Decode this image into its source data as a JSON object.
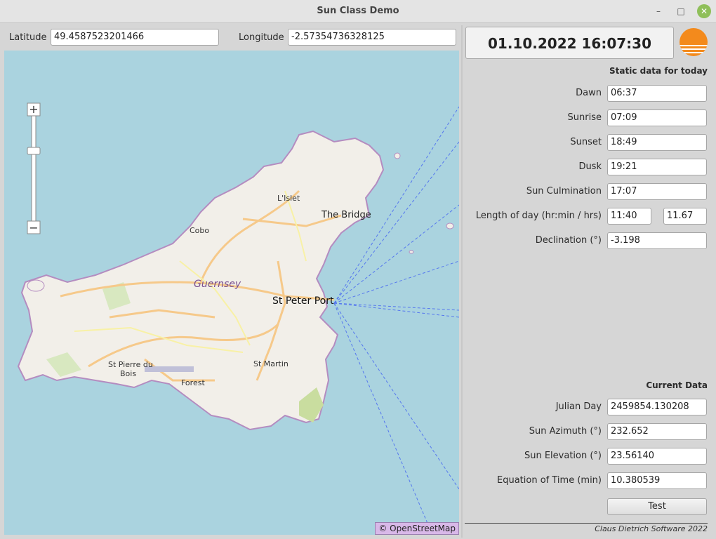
{
  "window": {
    "title": "Sun Class Demo"
  },
  "controls": {
    "minimize": "–",
    "maximize": "□",
    "close": "✕"
  },
  "coordinates": {
    "latitude_label": "Latitude",
    "latitude_value": "49.4587523201466",
    "longitude_label": "Longitude",
    "longitude_value": "-2.57354736328125"
  },
  "map": {
    "attribution": "© OpenStreetMap",
    "zoom_in": "+",
    "zoom_out": "−",
    "places": {
      "lislet": "L'Islet",
      "the_bridge": "The Bridge",
      "cobo": "Cobo",
      "guernsey": "Guernsey",
      "st_peter_port": "St Peter Port",
      "st_pierre_du": "St Pierre du",
      "bois": "Bois",
      "forest": "Forest",
      "st_martin": "St Martin"
    },
    "colors": {
      "sea": "#aad3df",
      "land": "#f2efe9",
      "road": "#f6c98a",
      "rays": "#5577ee"
    }
  },
  "datetime": "01.10.2022 16:07:30",
  "sun_icon_color": "#f38a1c",
  "static": {
    "title": "Static data for today",
    "dawn_label": "Dawn",
    "dawn": "06:37",
    "sunrise_label": "Sunrise",
    "sunrise": "07:09",
    "sunset_label": "Sunset",
    "sunset": "18:49",
    "dusk_label": "Dusk",
    "dusk": "19:21",
    "culmination_label": "Sun Culmination",
    "culmination": "17:07",
    "length_label": "Length of day (hr:min / hrs)",
    "length_hm": "11:40",
    "length_hrs": "11.67",
    "declination_label": "Declination (°)",
    "declination": "-3.198"
  },
  "current": {
    "title": "Current Data",
    "julian_label": "Julian Day",
    "julian": "2459854.130208",
    "azimuth_label": "Sun Azimuth (°)",
    "azimuth": "232.652",
    "elevation_label": "Sun Elevation (°)",
    "elevation": "23.56140",
    "eot_label": "Equation of Time (min)",
    "eot": "10.380539"
  },
  "test_button": "Test",
  "credit": "Claus Dietrich Software 2022"
}
